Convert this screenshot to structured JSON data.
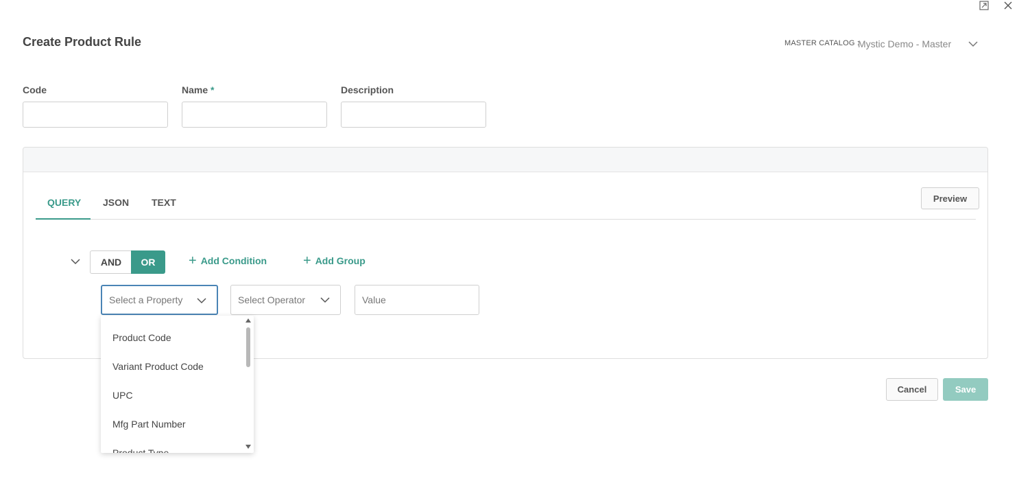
{
  "window": {
    "maximize_icon": "maximize-icon",
    "close_icon": "close-icon"
  },
  "header": {
    "title": "Create Product Rule",
    "catalog_label": "MASTER CATALOG :",
    "catalog_value": "Mystic Demo - Master"
  },
  "form": {
    "code_label": "Code",
    "name_label": "Name",
    "name_required": "*",
    "description_label": "Description",
    "code_value": "",
    "name_value": "",
    "description_value": ""
  },
  "tabs": {
    "query": "QUERY",
    "json": "JSON",
    "text": "TEXT",
    "active": "QUERY"
  },
  "preview_label": "Preview",
  "query": {
    "and_label": "AND",
    "or_label": "OR",
    "active_combinator": "OR",
    "add_condition": "Add Condition",
    "add_group": "Add Group",
    "property_placeholder": "Select a Property",
    "operator_placeholder": "Select Operator",
    "value_placeholder": "Value"
  },
  "property_options": [
    "Product Code",
    "Variant Product Code",
    "UPC",
    "Mfg Part Number",
    "Product Type"
  ],
  "footer": {
    "cancel_label": "Cancel",
    "save_label": "Save"
  },
  "colors": {
    "accent": "#3a9a8a",
    "save_disabled": "#93cbc0",
    "focus_border": "#4a84b5"
  }
}
